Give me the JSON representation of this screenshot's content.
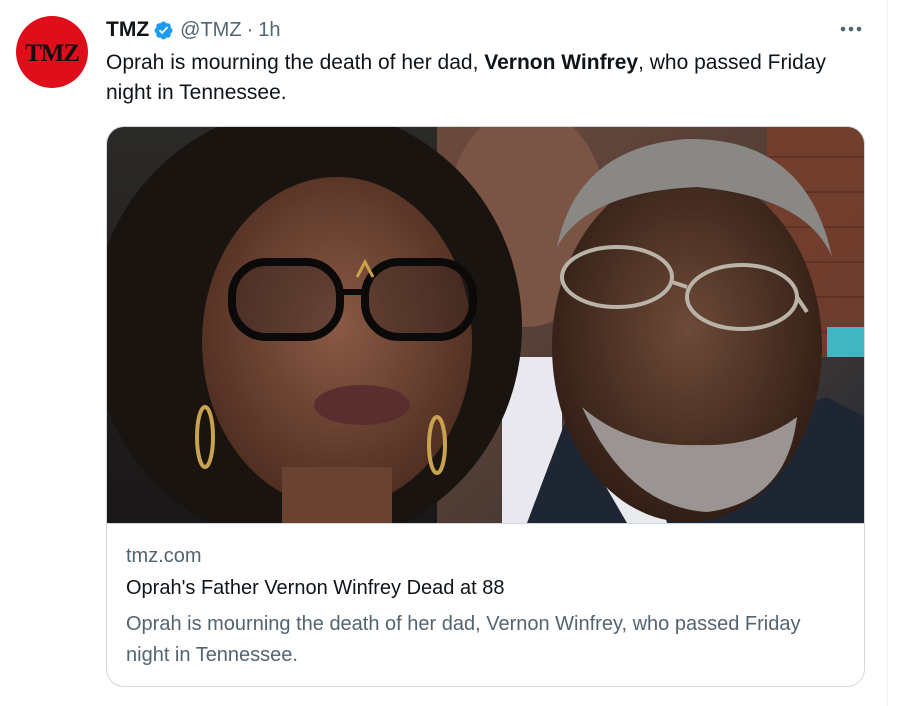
{
  "tweet": {
    "author_name": "TMZ",
    "avatar_text": "TMZ",
    "handle": "@TMZ",
    "separator": "·",
    "time": "1h",
    "text_before": "Oprah is mourning the death of her dad, ",
    "text_bold": "Vernon Winfrey",
    "text_after": ", who passed Friday night in Tennessee."
  },
  "card": {
    "domain": "tmz.com",
    "title": "Oprah's Father Vernon Winfrey Dead at 88",
    "description": "Oprah is mourning the death of her dad, Vernon Winfrey, who passed Friday night in Tennessee."
  },
  "icons": {
    "verified": "verified-badge-icon",
    "more": "more-options-icon"
  },
  "colors": {
    "brand_red": "#e00d1b",
    "verified_blue": "#1d9bf0",
    "secondary_text": "#536471",
    "primary_text": "#0f1419",
    "card_border": "#cfd9de"
  }
}
